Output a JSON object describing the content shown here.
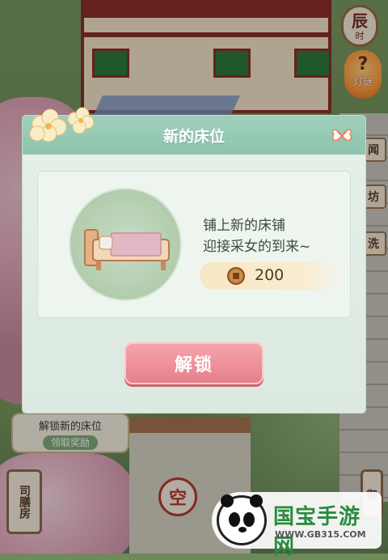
{
  "hud": {
    "time_char": "辰",
    "time_sub": "时",
    "lantern_mark": "?",
    "lantern_label": "灯谜",
    "side_tags": [
      "闻",
      "坊",
      "洗"
    ]
  },
  "quest": {
    "title": "解锁新的床位",
    "button": "领取奖励"
  },
  "scene_labels": {
    "kitchen": "司膳房",
    "empty_lantern": "空",
    "right_sign": "御"
  },
  "dialog": {
    "title": "新的床位",
    "description_line1": "铺上新的床铺",
    "description_line2": "迎接采女的到来~",
    "cost_value": "200",
    "unlock_button": "解锁",
    "cost_icon": "coin-icon",
    "close_icon": "butterfly-close-icon"
  },
  "watermark": {
    "logo_text": "国宝手游网",
    "url": "WWW.GB315.COM"
  },
  "colors": {
    "dialog_header": "#8ec4ae",
    "unlock_button": "#e57f8b",
    "cost_bg": "#f7e7c3"
  }
}
